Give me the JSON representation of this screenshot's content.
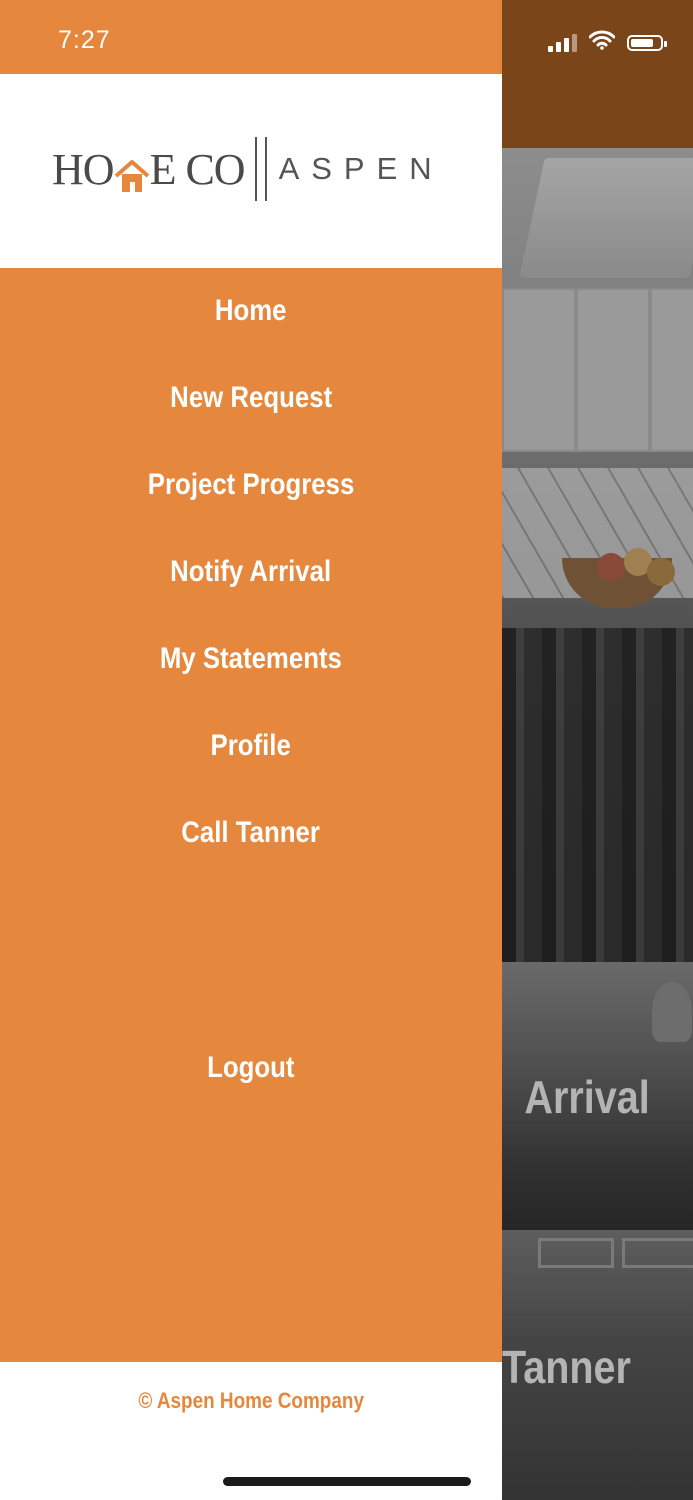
{
  "status_bar": {
    "time": "7:27",
    "battery_level": 0.8
  },
  "logo": {
    "word_left_1": "HO",
    "word_left_2": "E CO",
    "word_right": "ASPEN"
  },
  "menu": {
    "items": [
      {
        "label": "Home"
      },
      {
        "label": "New Request"
      },
      {
        "label": "Project Progress"
      },
      {
        "label": "Notify Arrival"
      },
      {
        "label": "My Statements"
      },
      {
        "label": "Profile"
      },
      {
        "label": "Call Tanner"
      }
    ],
    "logout_label": "Logout"
  },
  "footer": {
    "copyright": "© Aspen Home Company"
  },
  "background_cards": [
    {
      "label": "Arrival"
    },
    {
      "label": "Tanner"
    }
  ],
  "colors": {
    "accent": "#e5873c",
    "header_dark": "#7a4519"
  },
  "icons": [
    "signal-icon",
    "wifi-icon",
    "battery-icon",
    "house-icon"
  ]
}
